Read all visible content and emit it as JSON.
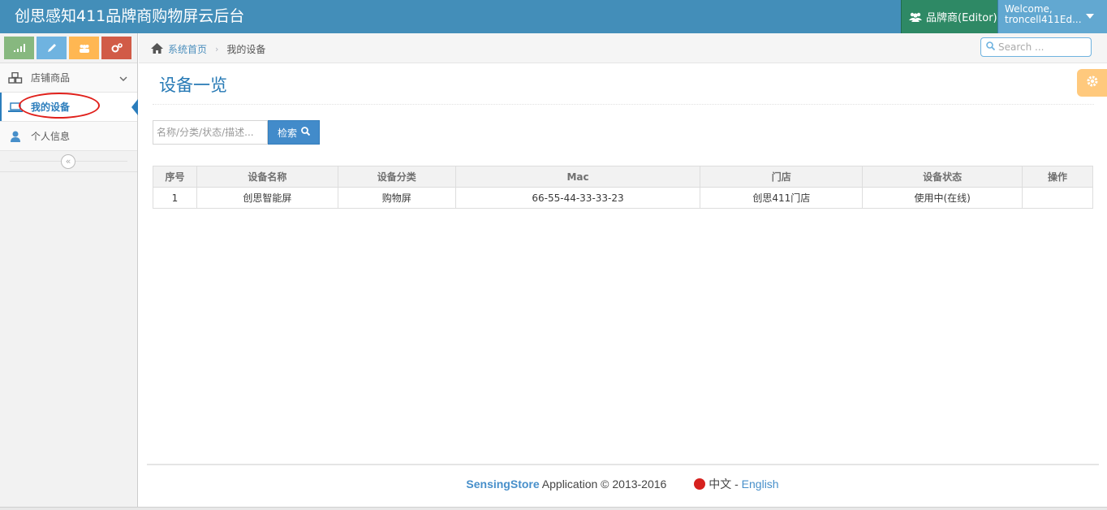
{
  "app": {
    "title": "创思感知411品牌商购物屏云后台"
  },
  "header": {
    "role_label": "品牌商(Editor)",
    "welcome_line1": "Welcome,",
    "welcome_line2": "troncell411Ed..."
  },
  "sidebar": {
    "shortcuts": [
      "signal-icon",
      "pencil-icon",
      "users-icon",
      "cogs-icon"
    ],
    "items": [
      {
        "label": "店铺商品",
        "icon": "cubes-icon"
      },
      {
        "label": "我的设备",
        "icon": "laptop-icon",
        "active": true
      },
      {
        "label": "个人信息",
        "icon": "user-icon"
      }
    ],
    "collapse_icon": "double-angle-left-icon"
  },
  "breadcrumbs": {
    "home": "系统首页",
    "current": "我的设备"
  },
  "search": {
    "placeholder": "Search ..."
  },
  "page": {
    "title": "设备一览"
  },
  "filter": {
    "placeholder": "名称/分类/状态/描述...",
    "button_label": "检索"
  },
  "table": {
    "headers": [
      "序号",
      "设备名称",
      "设备分类",
      "Mac",
      "门店",
      "设备状态",
      "操作"
    ],
    "rows": [
      [
        "1",
        "创思智能屏",
        "购物屏",
        "66-55-44-33-33-23",
        "创思411门店",
        "使用中(在线)",
        ""
      ]
    ]
  },
  "footer": {
    "brand": "SensingStore",
    "text": "Application © 2013-2016",
    "lang_zh": "中文",
    "separator": "-",
    "lang_en": "English"
  },
  "colors": {
    "navbar": "#438eb9",
    "role_button": "#2e8965",
    "user_button": "#62a8d1",
    "accent": "#2b7dbc",
    "highlight_annotation": "#e0201b"
  }
}
